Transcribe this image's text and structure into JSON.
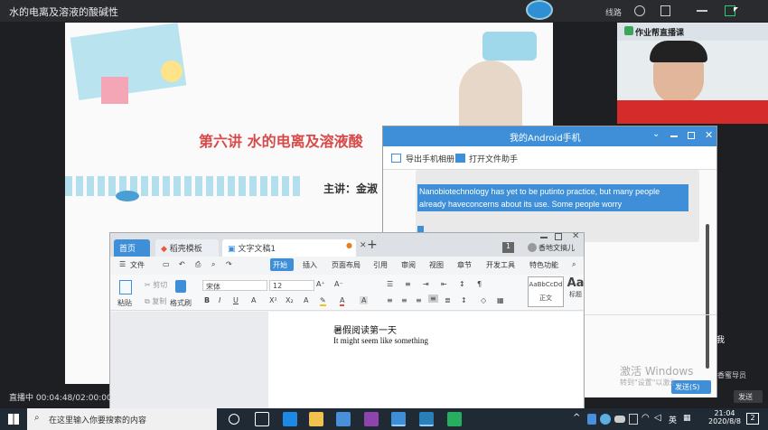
{
  "window": {
    "title": "水的电离及溶液的酸碱性",
    "line_label": "线路"
  },
  "slide": {
    "title": "第六讲 水的电离及溶液酸",
    "speaker": "主讲：金淑"
  },
  "cam": {
    "logo_text": "作业帮直播课"
  },
  "android": {
    "title": "我的Android手机",
    "export_label": "导出手机相册",
    "open_label": "打开文件助手",
    "message": "Nanobiotechnology has yet to be putinto practice, but many people already haveconcerns about its use. Some people worry",
    "send_label": "发送(S)",
    "side_label": "我",
    "send_outside": "发送"
  },
  "watermark": {
    "line1": "激活 Windows",
    "line2": "转到\"设置\"以激活 Windows。",
    "tag": "香蜜导员"
  },
  "wps": {
    "tab_home": "首页",
    "tab_daoke": "稻壳模板",
    "tab_doc": "文字文稿1",
    "tab_dot": "●",
    "plus": "+",
    "badge": "1",
    "tab_right": "香地文搞儿",
    "menu": [
      "文件",
      "开始",
      "插入",
      "页面布局",
      "引用",
      "审阅",
      "视图",
      "章节",
      "开发工具",
      "特色功能"
    ],
    "ribbon": {
      "paste": "粘贴",
      "cut": "剪切",
      "copy": "复制",
      "format": "格式刷",
      "font": "宋体",
      "size": "12",
      "style1": "AaBbCcDd",
      "style1_label": "正文",
      "style2": "Aa",
      "style2_label": "标题"
    },
    "doc_line1": "暑假阅读第一天",
    "doc_line2": "It might seem like something"
  },
  "status": {
    "live": "直播中 00:04:48/02:00:00"
  },
  "taskbar": {
    "search_placeholder": "在这里输入你要搜索的内容",
    "ime": "英",
    "time": "21:04",
    "date": "2020/8/8",
    "notif": "2"
  }
}
